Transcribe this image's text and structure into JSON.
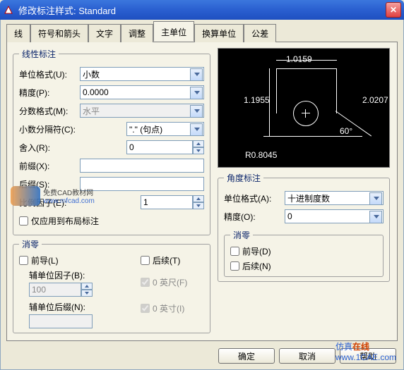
{
  "title": "修改标注样式: Standard",
  "tabs": [
    "线",
    "符号和箭头",
    "文字",
    "调整",
    "主单位",
    "换算单位",
    "公差"
  ],
  "active_tab_index": 4,
  "linear": {
    "legend": "线性标注",
    "unit_format_label": "单位格式(U):",
    "unit_format_value": "小数",
    "precision_label": "精度(P):",
    "precision_value": "0.0000",
    "frac_format_label": "分数格式(M):",
    "frac_format_value": "水平",
    "decimal_sep_label": "小数分隔符(C):",
    "decimal_sep_value": "\".\" (句点)",
    "round_label": "舍入(R):",
    "round_value": "0",
    "prefix_label": "前缀(X):",
    "prefix_value": "",
    "suffix_label": "后缀(S):",
    "suffix_value": "",
    "scale_factor_label": "比例因子(E):",
    "scale_factor_value": "1",
    "apply_layout_label": "仅应用到布局标注"
  },
  "suppress_linear": {
    "legend": "消零",
    "leading_label": "前导(L)",
    "trailing_label": "后续(T)",
    "sub_factor_label": "辅单位因子(B):",
    "sub_factor_value": "100",
    "feet_label": "0 英尺(F)",
    "sub_suffix_label": "辅单位后缀(N):",
    "sub_suffix_value": "",
    "inches_label": "0 英寸(I)"
  },
  "angular": {
    "legend": "角度标注",
    "unit_format_label": "单位格式(A):",
    "unit_format_value": "十进制度数",
    "precision_label": "精度(O):",
    "precision_value": "0",
    "suppress_legend": "消零",
    "leading_label": "前导(D)",
    "trailing_label": "后续(N)"
  },
  "preview": {
    "d1": "1.0159",
    "d2": "1.1955",
    "d3": "2.0207",
    "r": "R0.8045",
    "ang": "60°"
  },
  "buttons": {
    "ok": "确定",
    "cancel": "取消",
    "help": "帮助"
  },
  "watermark": {
    "line1": "免费CAD教材网",
    "line2": "www.mfcad.com"
  },
  "footer_wm": {
    "t1": "仿真",
    "t2": "在线",
    "url": "www.1CAE.com"
  }
}
